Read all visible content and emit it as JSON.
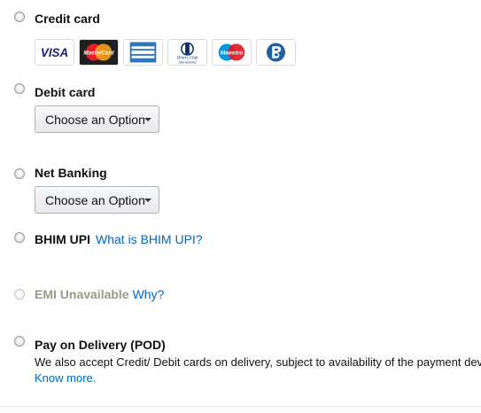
{
  "payment_options": {
    "credit_card": {
      "label": "Credit card",
      "card_icons": [
        "visa-icon",
        "mastercard-icon",
        "amex-icon",
        "diners-club-icon",
        "maestro-icon",
        "rupay-icon"
      ],
      "visa_text": "VISA",
      "mastercard_text": "MasterCard",
      "diners_text": "Diners Club",
      "diners_sub": "International",
      "maestro_text": "Maestro"
    },
    "debit_card": {
      "label": "Debit card",
      "select_value": "Choose an Option"
    },
    "net_banking": {
      "label": "Net Banking",
      "select_value": "Choose an Option"
    },
    "bhim_upi": {
      "label": "BHIM UPI",
      "link": "What is BHIM UPI?"
    },
    "emi": {
      "label": "EMI Unavailable",
      "link": "Why?"
    },
    "pod": {
      "label": "Pay on Delivery (POD)",
      "description": "We also accept Credit/ Debit cards on delivery, subject to availability of the payment dev",
      "link": "Know more."
    }
  },
  "colors": {
    "link": "#0066c0",
    "text": "#111111",
    "disabled_text": "#9a9a8c"
  }
}
